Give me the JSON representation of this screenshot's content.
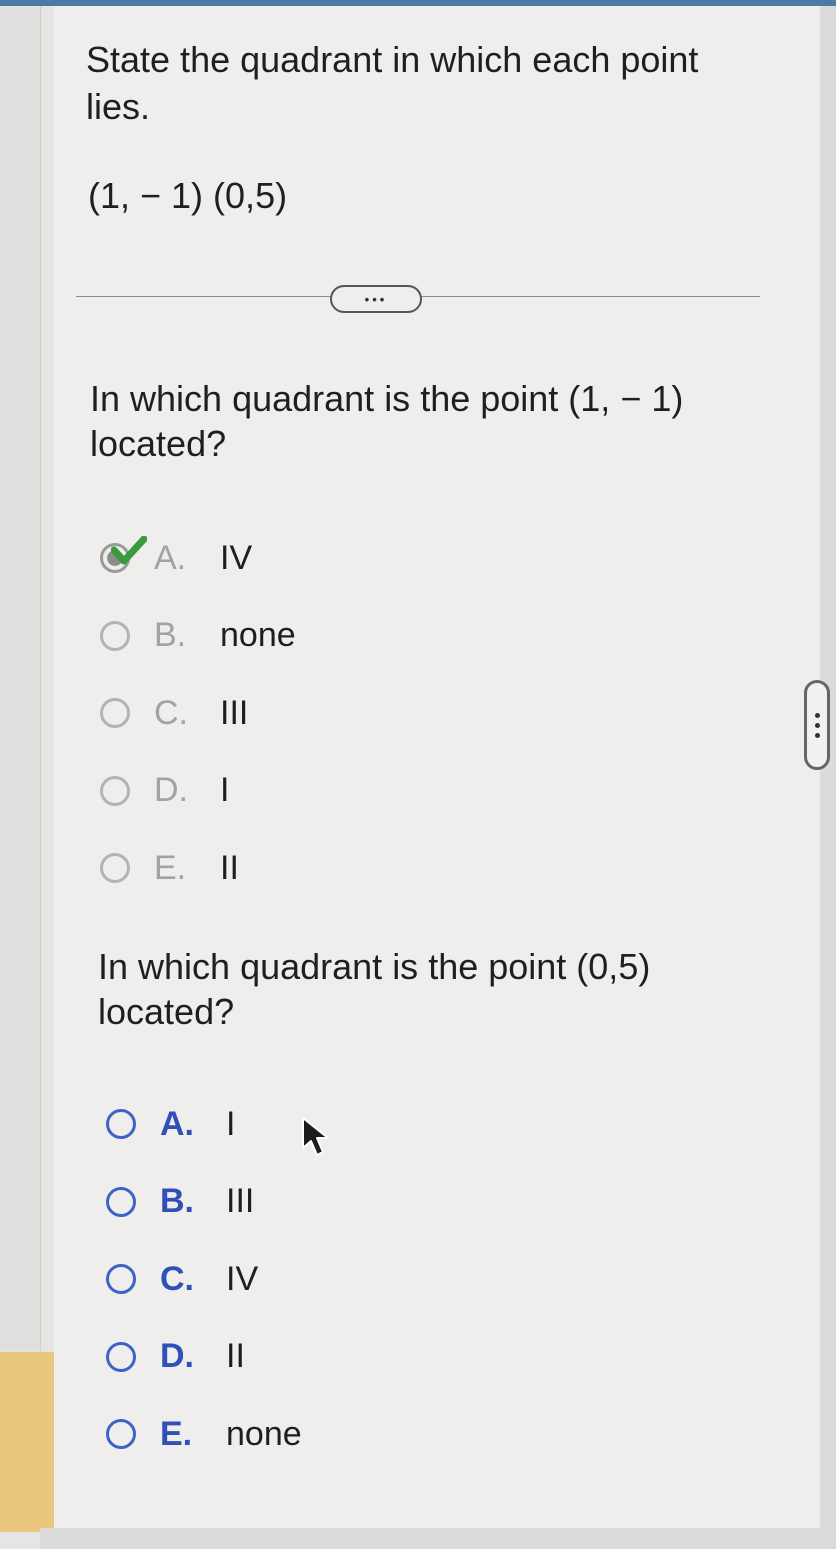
{
  "prompt": "State the quadrant in which each point lies.",
  "points": "(1, − 1)  (0,5)",
  "more_button": "•••",
  "question1": {
    "text": "In which quadrant is the point (1, − 1) located?",
    "options": [
      {
        "letter": "A.",
        "value": "IV",
        "selected": true,
        "correct": true
      },
      {
        "letter": "B.",
        "value": "none"
      },
      {
        "letter": "C.",
        "value": "III"
      },
      {
        "letter": "D.",
        "value": "I"
      },
      {
        "letter": "E.",
        "value": "II"
      }
    ]
  },
  "question2": {
    "text": "In which quadrant is the point (0,5) located?",
    "options": [
      {
        "letter": "A.",
        "value": "I"
      },
      {
        "letter": "B.",
        "value": "III"
      },
      {
        "letter": "C.",
        "value": "IV"
      },
      {
        "letter": "D.",
        "value": "II"
      },
      {
        "letter": "E.",
        "value": "none"
      }
    ]
  },
  "icons": {
    "correct_mark": "check-icon",
    "pointer": "cursor-arrow-icon",
    "side_handle": "vertical-ellipsis-icon"
  },
  "colors": {
    "top_bar": "#4a7ba6",
    "check": "#3a9a3e",
    "radio_active": "#3c63c8",
    "letter_active": "#2f50b7",
    "side_accent": "#e9c77c"
  }
}
